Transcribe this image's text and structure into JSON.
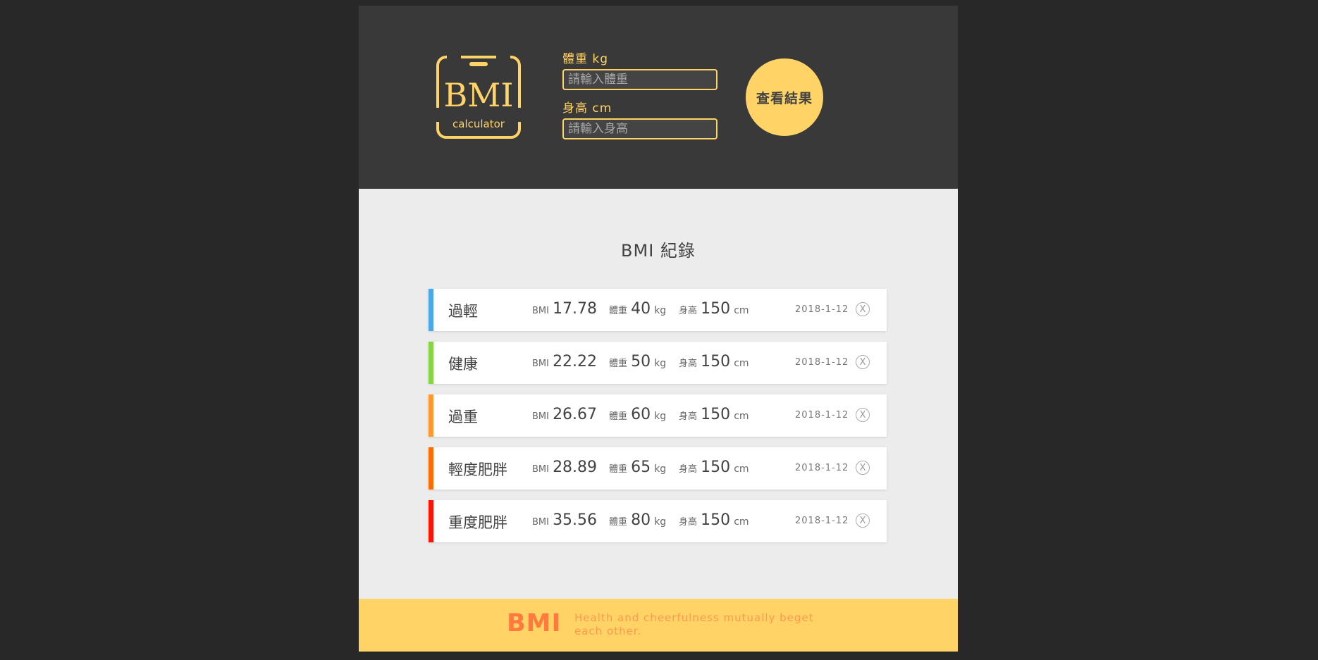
{
  "header": {
    "logo_main": "BMI",
    "logo_sub": "calculator",
    "weight_label": "體重 kg",
    "weight_placeholder": "請輸入體重",
    "weight_value": "",
    "height_label": "身高 cm",
    "height_placeholder": "請輸入身高",
    "height_value": "",
    "result_button": "查看結果"
  },
  "records": {
    "title": "BMI 紀錄",
    "bmi_label": "BMI",
    "weight_label": "體重",
    "weight_unit": "kg",
    "height_label": "身高",
    "height_unit": "cm",
    "delete_icon": "X",
    "items": [
      {
        "status": "過輕",
        "bmi": "17.78",
        "weight": "40",
        "height": "150",
        "date": "2018-1-12",
        "color": "#4aa8e9"
      },
      {
        "status": "健康",
        "bmi": "22.22",
        "weight": "50",
        "height": "150",
        "date": "2018-1-12",
        "color": "#86d73f"
      },
      {
        "status": "過重",
        "bmi": "26.67",
        "weight": "60",
        "height": "150",
        "date": "2018-1-12",
        "color": "#ff982d"
      },
      {
        "status": "輕度肥胖",
        "bmi": "28.89",
        "weight": "65",
        "height": "150",
        "date": "2018-1-12",
        "color": "#ff6c03"
      },
      {
        "status": "重度肥胖",
        "bmi": "35.56",
        "weight": "80",
        "height": "150",
        "date": "2018-1-12",
        "color": "#ff1200"
      }
    ]
  },
  "footer": {
    "logo": "BMI",
    "slogan": "Health and cheerfulness mutually beget each other."
  },
  "colors": {
    "accent": "#ffd366",
    "header_bg": "#393939",
    "page_bg": "#282828",
    "main_bg": "#ececec",
    "footer_text": "#ff7a3c"
  }
}
